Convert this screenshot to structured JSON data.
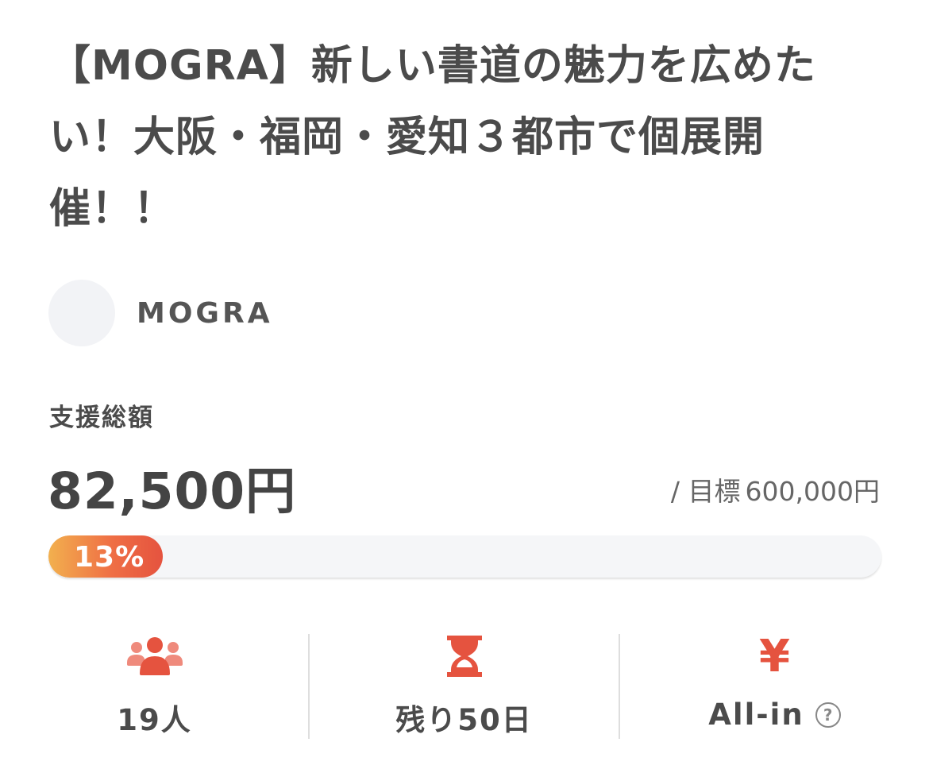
{
  "project": {
    "title": "【MOGRA】新しい書道の魅力を広めたい！大阪・福岡・愛知３都市で個展開催！！",
    "owner_name": "MOGRA"
  },
  "funding": {
    "label": "支援総額",
    "amount": "82,500円",
    "goal_prefix": "/ 目標",
    "goal_amount": "600,000円",
    "progress_label": "13%",
    "progress_value": 0.1375
  },
  "stats": {
    "supporters": "19人",
    "remaining": "残り50日",
    "type": "All-in",
    "help_symbol": "?"
  },
  "icons": {
    "supporters": "people-icon",
    "remaining": "hourglass-icon",
    "type": "yen-icon",
    "help": "question-circle-icon"
  },
  "colors": {
    "accent": "#e5533f",
    "accent_light": "#ef8a7c",
    "gradient_start": "#f2b04e",
    "track": "#f5f6f8",
    "text": "#4b4b4b"
  }
}
